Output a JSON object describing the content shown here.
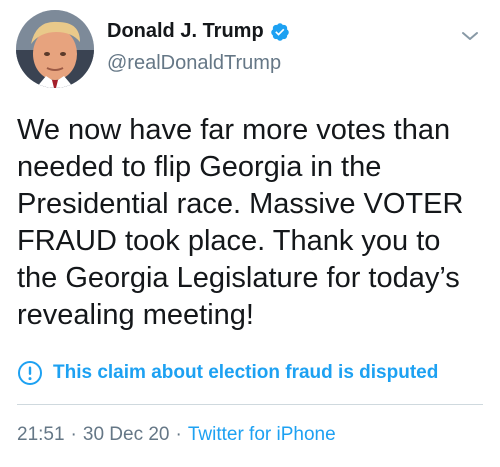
{
  "author": {
    "display_name": "Donald J. Trump",
    "handle": "@realDonaldTrump",
    "verified": true,
    "avatar_icon": "profile-photo"
  },
  "tweet": {
    "text": "We now have far more votes than needed to flip Georgia in the Presidential race. Massive VOTER FRAUD took place. Thank you to the Georgia Legislature for today’s revealing meeting!"
  },
  "label": {
    "icon": "exclamation-circle-icon",
    "text": "This claim about election fraud is disputed"
  },
  "meta": {
    "time": "21:51",
    "separator": "·",
    "date": "30 Dec 20",
    "source": "Twitter for iPhone"
  },
  "colors": {
    "accent": "#1da1f2",
    "text": "#14171a",
    "secondary": "#657786",
    "divider": "#cfd9de"
  }
}
